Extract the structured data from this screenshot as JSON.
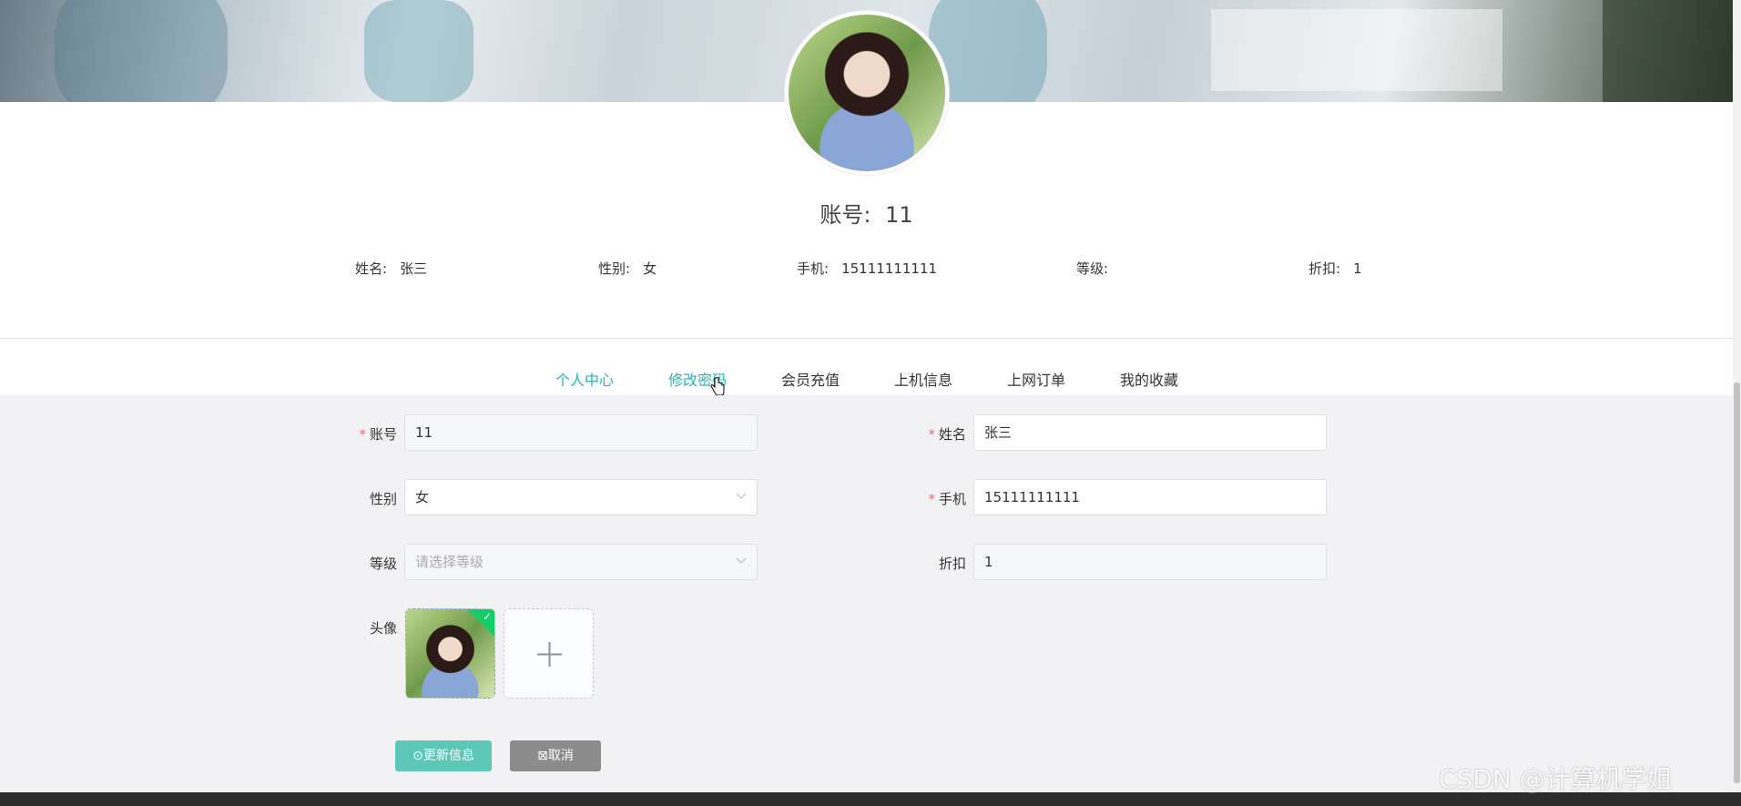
{
  "profile": {
    "account_label": "账号:",
    "account_value": "11",
    "fields": [
      {
        "label": "姓名:",
        "value": "张三"
      },
      {
        "label": "性别:",
        "value": "女"
      },
      {
        "label": "手机:",
        "value": "15111111111"
      },
      {
        "label": "等级:",
        "value": ""
      },
      {
        "label": "折扣:",
        "value": "1"
      }
    ]
  },
  "tabs": [
    {
      "label": "个人中心",
      "active": true
    },
    {
      "label": "修改密码",
      "active": true
    },
    {
      "label": "会员充值",
      "active": false
    },
    {
      "label": "上机信息",
      "active": false
    },
    {
      "label": "上网订单",
      "active": false
    },
    {
      "label": "我的收藏",
      "active": false
    }
  ],
  "form": {
    "account": {
      "label": "账号",
      "value": "11",
      "required": true
    },
    "name": {
      "label": "姓名",
      "value": "张三",
      "required": true
    },
    "gender": {
      "label": "性别",
      "value": "女"
    },
    "phone": {
      "label": "手机",
      "value": "15111111111",
      "required": true
    },
    "level": {
      "label": "等级",
      "placeholder": "请选择等级"
    },
    "discount": {
      "label": "折扣",
      "value": "1"
    },
    "avatar": {
      "label": "头像"
    }
  },
  "buttons": {
    "update": "⊙更新信息",
    "cancel": "⊠取消"
  },
  "watermark": "CSDN @计算机学姐",
  "colors": {
    "accent": "#28b6b6",
    "primary_button": "#5ec8b8",
    "cancel_button": "#8c8c8c",
    "required": "#f56c6c",
    "upload_success": "#13ce66"
  }
}
